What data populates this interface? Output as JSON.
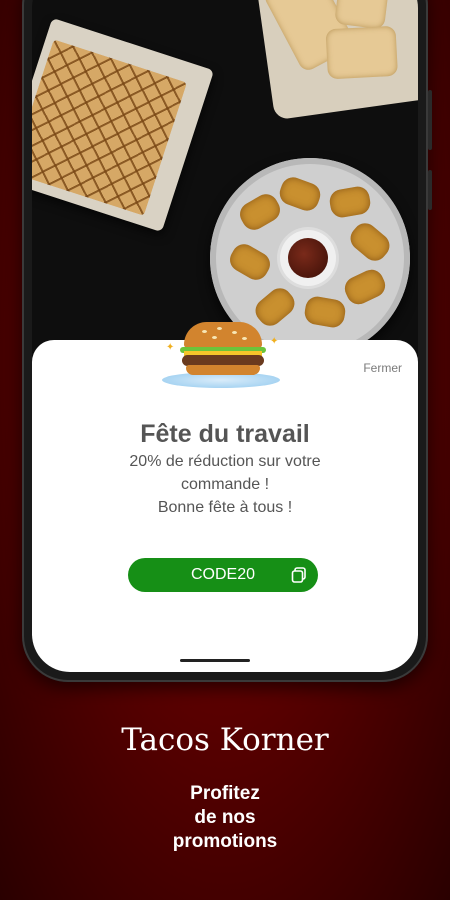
{
  "popup": {
    "close_label": "Fermer",
    "title": "Fête du travail",
    "message_line1": "20% de réduction sur votre",
    "message_line2": "commande !",
    "message_line3": "Bonne fête à tous !",
    "promo_code": "CODE20",
    "icons": {
      "burger": "burger-icon",
      "copy": "copy-icon"
    },
    "colors": {
      "code_button": "#168f16",
      "title_text": "#555555"
    }
  },
  "promo": {
    "brand": "Tacos Korner",
    "tagline_line1": "Profitez",
    "tagline_line2": "de nos",
    "tagline_line3": "promotions"
  },
  "colors": {
    "background": "#6a0000"
  }
}
